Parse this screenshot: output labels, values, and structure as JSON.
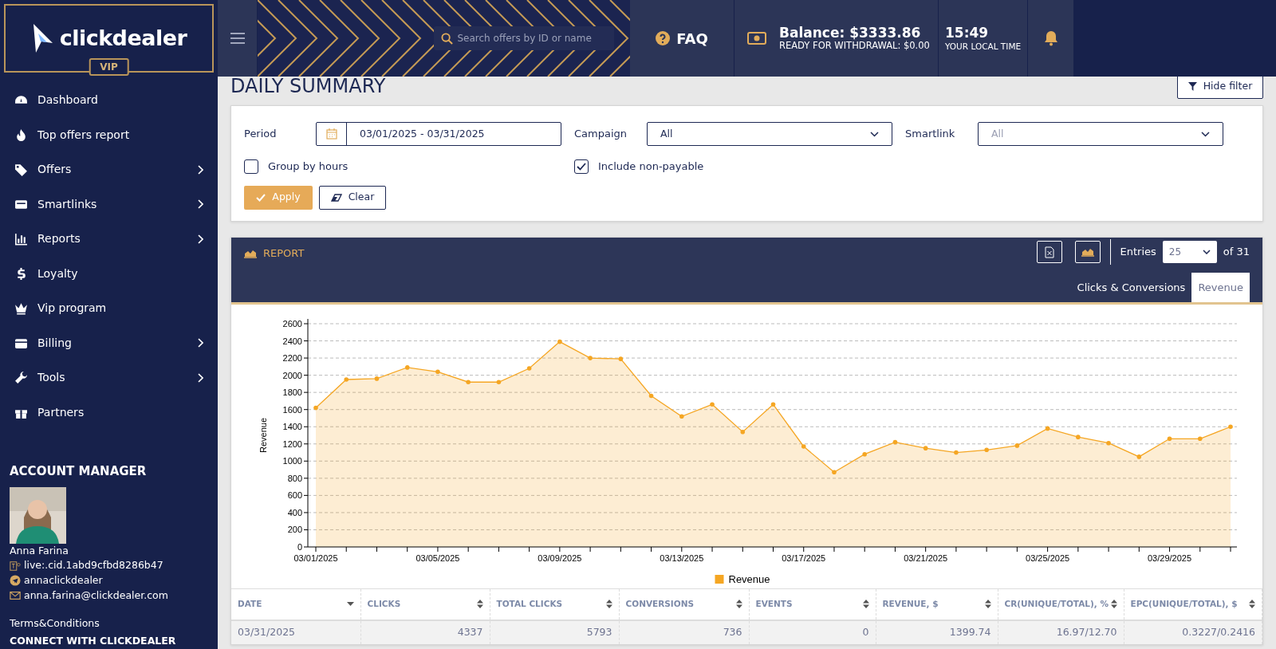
{
  "logo": {
    "brand": "clickdealer",
    "badge": "VIP"
  },
  "header": {
    "search": {
      "placeholder": "Search offers by ID or name"
    },
    "faq": "FAQ",
    "balance": {
      "label": "Balance: $3333.86",
      "sub": "READY FOR WITHDRAWAL: $0.00"
    },
    "time": {
      "value": "15:49",
      "label": "YOUR LOCAL TIME"
    }
  },
  "sidebar": {
    "items": [
      {
        "label": "Dashboard",
        "has_children": false
      },
      {
        "label": "Top offers report",
        "has_children": false
      },
      {
        "label": "Offers",
        "has_children": true
      },
      {
        "label": "Smartlinks",
        "has_children": true
      },
      {
        "label": "Reports",
        "has_children": true
      },
      {
        "label": "Loyalty",
        "has_children": false
      },
      {
        "label": "Vip program",
        "has_children": false
      },
      {
        "label": "Billing",
        "has_children": true
      },
      {
        "label": "Tools",
        "has_children": true
      },
      {
        "label": "Partners",
        "has_children": false
      }
    ]
  },
  "account_manager": {
    "title": "ACCOUNT MANAGER",
    "name": "Anna Farina",
    "contacts": [
      {
        "kind": "teams",
        "text": "live:.cid.1abd9cfbd8286b47"
      },
      {
        "kind": "telegram",
        "text": "annaclickdealer"
      },
      {
        "kind": "email",
        "text": "anna.farina@clickdealer.com"
      }
    ],
    "terms": "Terms&Conditions",
    "connect": "CONNECT WITH CLICKDEALER"
  },
  "page": {
    "title": "DAILY SUMMARY",
    "hide_filter": "Hide filter"
  },
  "filter": {
    "period": {
      "label": "Period",
      "value": "03/01/2025 - 03/31/2025"
    },
    "campaign": {
      "label": "Campaign",
      "value": "All"
    },
    "smartlink": {
      "label": "Smartlink",
      "placeholder": "All"
    },
    "checkboxes": [
      {
        "label": "Group by hours",
        "checked": false
      },
      {
        "label": "Include non-payable",
        "checked": true
      }
    ],
    "apply": "Apply",
    "clear": "Clear"
  },
  "report": {
    "title": "REPORT",
    "entries_label": "Entries",
    "entries": "25",
    "total": "of 31",
    "tabs": [
      {
        "label": "Clicks & Conversions",
        "selected": false
      },
      {
        "label": "Revenue",
        "selected": true
      }
    ],
    "chart_data": {
      "type": "area",
      "ylabel": "Revenue",
      "categories": [
        "03/01/2025",
        null,
        null,
        null,
        "03/05/2025",
        null,
        null,
        null,
        "03/09/2025",
        null,
        null,
        null,
        "03/13/2025",
        null,
        null,
        null,
        "03/17/2025",
        null,
        null,
        null,
        "03/21/2025",
        null,
        null,
        null,
        "03/25/2025",
        null,
        null,
        null,
        "03/29/2025",
        null,
        null
      ],
      "series": [
        {
          "name": "Revenue",
          "color": "#f5a623",
          "values": [
            1620,
            1950,
            1960,
            2090,
            2040,
            1920,
            1920,
            2080,
            2390,
            2200,
            2190,
            1760,
            1520,
            1660,
            1340,
            1660,
            1170,
            870,
            1080,
            1220,
            1150,
            1100,
            1130,
            1180,
            1380,
            1280,
            1210,
            1050,
            1260,
            1260,
            1400
          ]
        }
      ],
      "grid": true,
      "ylim": [
        0,
        2600
      ],
      "yticks": [
        0,
        200,
        400,
        600,
        800,
        1000,
        1200,
        1400,
        1600,
        1800,
        2000,
        2200,
        2400,
        2600
      ]
    },
    "table": {
      "columns": [
        {
          "label": "DATE",
          "sorted": true
        },
        {
          "label": "CLICKS",
          "sorted": false
        },
        {
          "label": "TOTAL CLICKS",
          "sorted": false
        },
        {
          "label": "CONVERSIONS",
          "sorted": false
        },
        {
          "label": "EVENTS",
          "sorted": false
        },
        {
          "label": "REVENUE, $",
          "sorted": false
        },
        {
          "label": "CR(UNIQUE/TOTAL), %",
          "sorted": false
        },
        {
          "label": "EPC(UNIQUE/TOTAL), $",
          "sorted": false
        }
      ],
      "rows": [
        [
          "03/31/2025",
          "4337",
          "5793",
          "736",
          "0",
          "1399.74",
          "16.97/12.70",
          "0.3227/0.2416"
        ]
      ]
    }
  }
}
